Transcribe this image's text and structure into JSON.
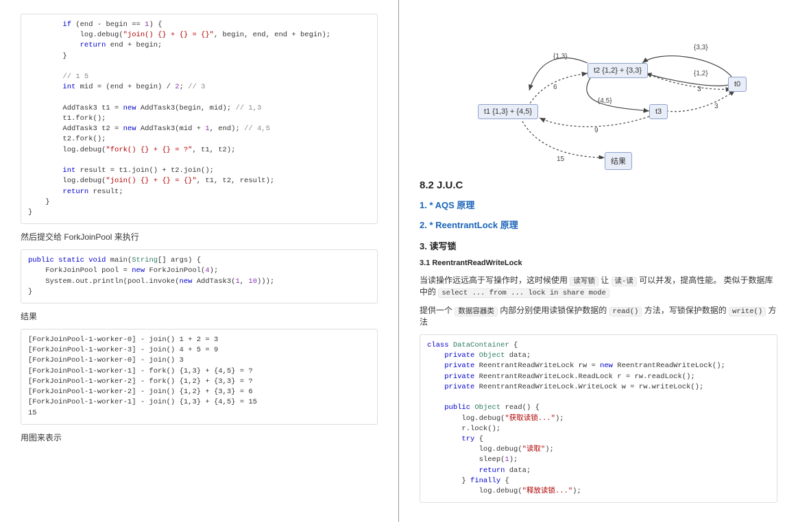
{
  "left": {
    "code1_lines": [
      {
        "indent": 2,
        "segs": [
          {
            "c": "kw",
            "t": "if"
          },
          {
            "t": " (end - begin == "
          },
          {
            "c": "num",
            "t": "1"
          },
          {
            "t": ") {"
          }
        ]
      },
      {
        "indent": 3,
        "segs": [
          {
            "t": "log.debug("
          },
          {
            "c": "str",
            "t": "\"join() {} + {} = {}\""
          },
          {
            "t": ", begin, end, end + begin);"
          }
        ]
      },
      {
        "indent": 3,
        "segs": [
          {
            "c": "kw",
            "t": "return"
          },
          {
            "t": " end + begin;"
          }
        ]
      },
      {
        "indent": 2,
        "segs": [
          {
            "t": "}"
          }
        ]
      },
      {
        "indent": 2,
        "segs": [
          {
            "t": ""
          }
        ]
      },
      {
        "indent": 2,
        "segs": [
          {
            "c": "cmt",
            "t": "// 1 5"
          }
        ]
      },
      {
        "indent": 2,
        "segs": [
          {
            "c": "kw",
            "t": "int"
          },
          {
            "t": " mid = (end + begin) / "
          },
          {
            "c": "num",
            "t": "2"
          },
          {
            "t": "; "
          },
          {
            "c": "cmt",
            "t": "// 3"
          }
        ]
      },
      {
        "indent": 2,
        "segs": [
          {
            "t": ""
          }
        ]
      },
      {
        "indent": 2,
        "segs": [
          {
            "t": "AddTask3 t1 = "
          },
          {
            "c": "kw",
            "t": "new"
          },
          {
            "t": " AddTask3(begin, mid); "
          },
          {
            "c": "cmt",
            "t": "// 1,3"
          }
        ]
      },
      {
        "indent": 2,
        "segs": [
          {
            "t": "t1.fork();"
          }
        ]
      },
      {
        "indent": 2,
        "segs": [
          {
            "t": "AddTask3 t2 = "
          },
          {
            "c": "kw",
            "t": "new"
          },
          {
            "t": " AddTask3(mid + "
          },
          {
            "c": "num",
            "t": "1"
          },
          {
            "t": ", end); "
          },
          {
            "c": "cmt",
            "t": "// 4,5"
          }
        ]
      },
      {
        "indent": 2,
        "segs": [
          {
            "t": "t2.fork();"
          }
        ]
      },
      {
        "indent": 2,
        "segs": [
          {
            "t": "log.debug("
          },
          {
            "c": "str",
            "t": "\"fork() {} + {} = ?\""
          },
          {
            "t": ", t1, t2);"
          }
        ]
      },
      {
        "indent": 2,
        "segs": [
          {
            "t": ""
          }
        ]
      },
      {
        "indent": 2,
        "segs": [
          {
            "c": "kw",
            "t": "int"
          },
          {
            "t": " result = t1.join() + t2.join();"
          }
        ]
      },
      {
        "indent": 2,
        "segs": [
          {
            "t": "log.debug("
          },
          {
            "c": "str",
            "t": "\"join() {} + {} = {}\""
          },
          {
            "t": ", t1, t2, result);"
          }
        ]
      },
      {
        "indent": 2,
        "segs": [
          {
            "c": "kw",
            "t": "return"
          },
          {
            "t": " result;"
          }
        ]
      },
      {
        "indent": 1,
        "segs": [
          {
            "t": "}"
          }
        ]
      },
      {
        "indent": 0,
        "segs": [
          {
            "t": "}"
          }
        ]
      }
    ],
    "p1": "然后提交给 ForkJoinPool 来执行",
    "code2_lines": [
      {
        "indent": 0,
        "segs": [
          {
            "c": "kw",
            "t": "public static "
          },
          {
            "c": "kw",
            "t": "void"
          },
          {
            "t": " main("
          },
          {
            "c": "typ",
            "t": "String"
          },
          {
            "t": "[] args) {"
          }
        ]
      },
      {
        "indent": 1,
        "segs": [
          {
            "t": "ForkJoinPool pool = "
          },
          {
            "c": "kw",
            "t": "new"
          },
          {
            "t": " ForkJoinPool("
          },
          {
            "c": "num",
            "t": "4"
          },
          {
            "t": ");"
          }
        ]
      },
      {
        "indent": 1,
        "segs": [
          {
            "t": "System.out.println(pool.invoke("
          },
          {
            "c": "kw",
            "t": "new"
          },
          {
            "t": " AddTask3("
          },
          {
            "c": "num",
            "t": "1"
          },
          {
            "t": ", "
          },
          {
            "c": "num",
            "t": "10"
          },
          {
            "t": ")));"
          }
        ]
      },
      {
        "indent": 0,
        "segs": [
          {
            "t": "}"
          }
        ]
      }
    ],
    "p2": "结果",
    "output_lines": [
      "[ForkJoinPool-1-worker-0] - join() 1 + 2 = 3",
      "[ForkJoinPool-1-worker-3] - join() 4 + 5 = 9",
      "[ForkJoinPool-1-worker-0] - join() 3",
      "[ForkJoinPool-1-worker-1] - fork() {1,3} + {4,5} = ?",
      "[ForkJoinPool-1-worker-2] - fork() {1,2} + {3,3} = ?",
      "[ForkJoinPool-1-worker-2] - join() {1,2} + {3,3} = 6",
      "[ForkJoinPool-1-worker-1] - join() {1,3} + {4,5} = 15",
      "15"
    ],
    "p3": "用图来表示"
  },
  "right": {
    "diagram": {
      "nodes": {
        "t0": "t0",
        "t1": "t1 {1,3} + {4,5}",
        "t2": "t2 {1,2} + {3,3}",
        "t3": "t3",
        "res": "结果"
      },
      "labels": {
        "e33": "{3,3}",
        "e12": "{1,2}",
        "e13": "{1,3}",
        "e45": "{4,5}",
        "n3a": "3",
        "n3b": "3",
        "n6": "6",
        "n9": "9",
        "n15": "15"
      }
    },
    "h_juc": "8.2 J.U.C",
    "h_aqs": "1. * AQS 原理",
    "h_rlock": "2. * ReentrantLock 原理",
    "h_rw": "3. 读写锁",
    "h_rrwl": "3.1 ReentrantReadWriteLock",
    "p_rw1_a": "当读操作远远高于写操作时，这时候使用 ",
    "p_rw1_code1": "读写锁",
    "p_rw1_b": " 让 ",
    "p_rw1_code2": "读-读",
    "p_rw1_c": " 可以并发，提高性能。 类似于数据库中的 ",
    "p_rw1_code3": "select ... from ... lock in share mode",
    "p_rw2_a": "提供一个 ",
    "p_rw2_code1": "数据容器类",
    "p_rw2_b": " 内部分别使用读锁保护数据的 ",
    "p_rw2_code2": "read()",
    "p_rw2_c": " 方法，写锁保护数据的 ",
    "p_rw2_code3": "write()",
    "p_rw2_d": " 方法",
    "code3_lines": [
      {
        "indent": 0,
        "segs": [
          {
            "c": "kw",
            "t": "class"
          },
          {
            "t": " "
          },
          {
            "c": "typ",
            "t": "DataContainer"
          },
          {
            "t": " {"
          }
        ]
      },
      {
        "indent": 1,
        "segs": [
          {
            "c": "kw",
            "t": "private"
          },
          {
            "t": " "
          },
          {
            "c": "typ",
            "t": "Object"
          },
          {
            "t": " data;"
          }
        ]
      },
      {
        "indent": 1,
        "segs": [
          {
            "c": "kw",
            "t": "private"
          },
          {
            "t": " ReentrantReadWriteLock rw = "
          },
          {
            "c": "kw",
            "t": "new"
          },
          {
            "t": " ReentrantReadWriteLock();"
          }
        ]
      },
      {
        "indent": 1,
        "segs": [
          {
            "c": "kw",
            "t": "private"
          },
          {
            "t": " ReentrantReadWriteLock.ReadLock r = rw.readLock();"
          }
        ]
      },
      {
        "indent": 1,
        "segs": [
          {
            "c": "kw",
            "t": "private"
          },
          {
            "t": " ReentrantReadWriteLock.WriteLock w = rw.writeLock();"
          }
        ]
      },
      {
        "indent": 1,
        "segs": [
          {
            "t": ""
          }
        ]
      },
      {
        "indent": 1,
        "segs": [
          {
            "c": "kw",
            "t": "public"
          },
          {
            "t": " "
          },
          {
            "c": "typ",
            "t": "Object"
          },
          {
            "t": " read() {"
          }
        ]
      },
      {
        "indent": 2,
        "segs": [
          {
            "t": "log.debug("
          },
          {
            "c": "str",
            "t": "\"获取读锁...\""
          },
          {
            "t": ");"
          }
        ]
      },
      {
        "indent": 2,
        "segs": [
          {
            "t": "r.lock();"
          }
        ]
      },
      {
        "indent": 2,
        "segs": [
          {
            "c": "kw",
            "t": "try"
          },
          {
            "t": " {"
          }
        ]
      },
      {
        "indent": 3,
        "segs": [
          {
            "t": "log.debug("
          },
          {
            "c": "str",
            "t": "\"读取\""
          },
          {
            "t": ");"
          }
        ]
      },
      {
        "indent": 3,
        "segs": [
          {
            "t": "sleep("
          },
          {
            "c": "num",
            "t": "1"
          },
          {
            "t": ");"
          }
        ]
      },
      {
        "indent": 3,
        "segs": [
          {
            "c": "kw",
            "t": "return"
          },
          {
            "t": " data;"
          }
        ]
      },
      {
        "indent": 2,
        "segs": [
          {
            "t": "} "
          },
          {
            "c": "kw",
            "t": "finally"
          },
          {
            "t": " {"
          }
        ]
      },
      {
        "indent": 3,
        "segs": [
          {
            "t": "log.debug("
          },
          {
            "c": "str",
            "t": "\"释放读锁...\""
          },
          {
            "t": ");"
          }
        ]
      }
    ]
  }
}
